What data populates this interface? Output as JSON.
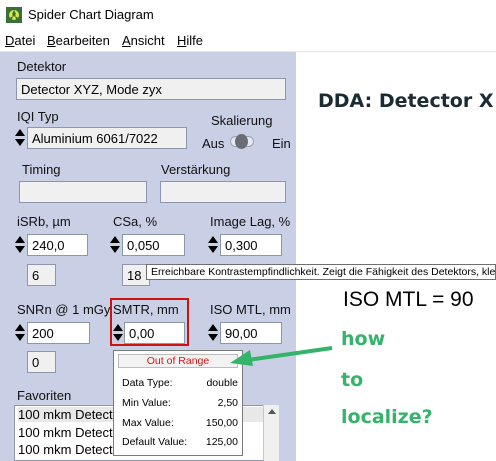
{
  "window": {
    "title": "Spider Chart Diagram"
  },
  "menu": [
    {
      "label": "Datei",
      "hotkey": "D",
      "rest": "atei"
    },
    {
      "label": "Bearbeiten",
      "hotkey": "B",
      "rest": "earbeiten"
    },
    {
      "label": "Ansicht",
      "hotkey": "A",
      "rest": "nsicht"
    },
    {
      "label": "Hilfe",
      "hotkey": "H",
      "rest": "ilfe"
    }
  ],
  "detektor": {
    "label": "Detektor",
    "value": "Detector XYZ, Mode zyx"
  },
  "iqi": {
    "label": "IQI Typ",
    "value": "Aluminium 6061/7022"
  },
  "skalierung": {
    "label": "Skalierung",
    "off": "Aus",
    "on": "Ein",
    "state": "Aus"
  },
  "timing": {
    "label": "Timing",
    "value": ""
  },
  "verstaerkung": {
    "label": "Verstärkung",
    "value": ""
  },
  "isrb": {
    "label": "iSRb, µm",
    "value": "240,0",
    "count": "6"
  },
  "csa": {
    "label": "CSa, %",
    "value": "0,050",
    "count": "18"
  },
  "image_lag": {
    "label": "Image Lag, %",
    "value": "0,300"
  },
  "snrn": {
    "label": "SNRn @ 1 mGy",
    "value": "200"
  },
  "smtr": {
    "label": "SMTR, mm",
    "value": "0,00",
    "count": "0"
  },
  "iso_mtl": {
    "label": "ISO MTL, mm",
    "value": "90,00"
  },
  "tooltip": {
    "text": "Erreichbare Kontrastempfindlichkeit. Zeigt die Fähigkeit des Detektors, kle"
  },
  "popup": {
    "title": "Out of Range",
    "rows": [
      {
        "key": "Data Type:",
        "value": "double"
      },
      {
        "key": "Min Value:",
        "value": "2,50"
      },
      {
        "key": "Max Value:",
        "value": "150,00"
      },
      {
        "key": "Default Value:",
        "value": "125,00"
      }
    ]
  },
  "favoriten": {
    "label": "Favoriten",
    "items": [
      "100 mkm Detect",
      "100 mkm Detect",
      "100 mkm Detect"
    ]
  },
  "right": {
    "heading": "DDA: Detector X",
    "iso_mtl_text": "ISO MTL = 90",
    "annotation": [
      "how",
      "to",
      "localize?"
    ]
  },
  "colors": {
    "panel": "#c9cfe4",
    "highlight": "#d11010",
    "annotation": "#34b36a"
  }
}
